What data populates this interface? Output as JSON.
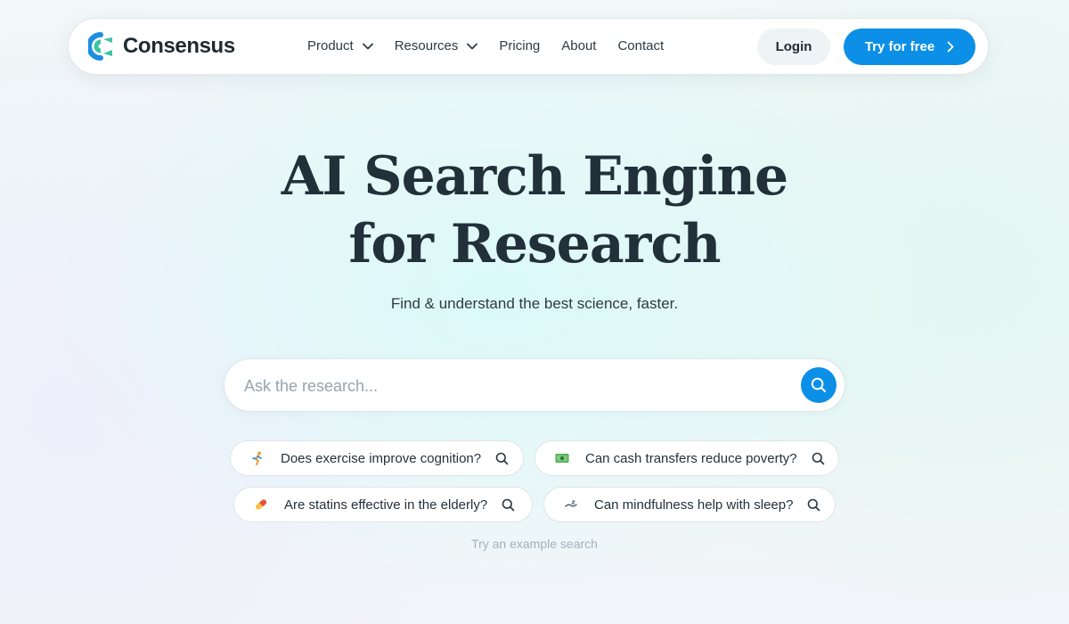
{
  "brand": {
    "name": "Consensus",
    "logo_colors": {
      "blue": "#1d8fe1",
      "green": "#3ac5a2"
    }
  },
  "nav": {
    "links": [
      {
        "label": "Product",
        "dropdown": true
      },
      {
        "label": "Resources",
        "dropdown": true
      },
      {
        "label": "Pricing",
        "dropdown": false
      },
      {
        "label": "About",
        "dropdown": false
      },
      {
        "label": "Contact",
        "dropdown": false
      }
    ],
    "login_label": "Login",
    "cta_label": "Try for free"
  },
  "hero": {
    "title_line1": "AI Search Engine",
    "title_line2": "for Research",
    "subtitle": "Find & understand the best science, faster."
  },
  "search": {
    "placeholder": "Ask the research...",
    "value": ""
  },
  "examples": {
    "hint": "Try an example search",
    "items": [
      {
        "icon": "running-person-icon",
        "label": "Does exercise improve cognition?"
      },
      {
        "icon": "cash-icon",
        "label": "Can cash transfers reduce poverty?"
      },
      {
        "icon": "pill-icon",
        "label": "Are statins effective in the elderly?"
      },
      {
        "icon": "sleep-icon",
        "label": "Can mindfulness help with sleep?"
      }
    ]
  },
  "colors": {
    "accent": "#0c8fe6",
    "text": "#22303a",
    "muted": "#96a4ac"
  }
}
